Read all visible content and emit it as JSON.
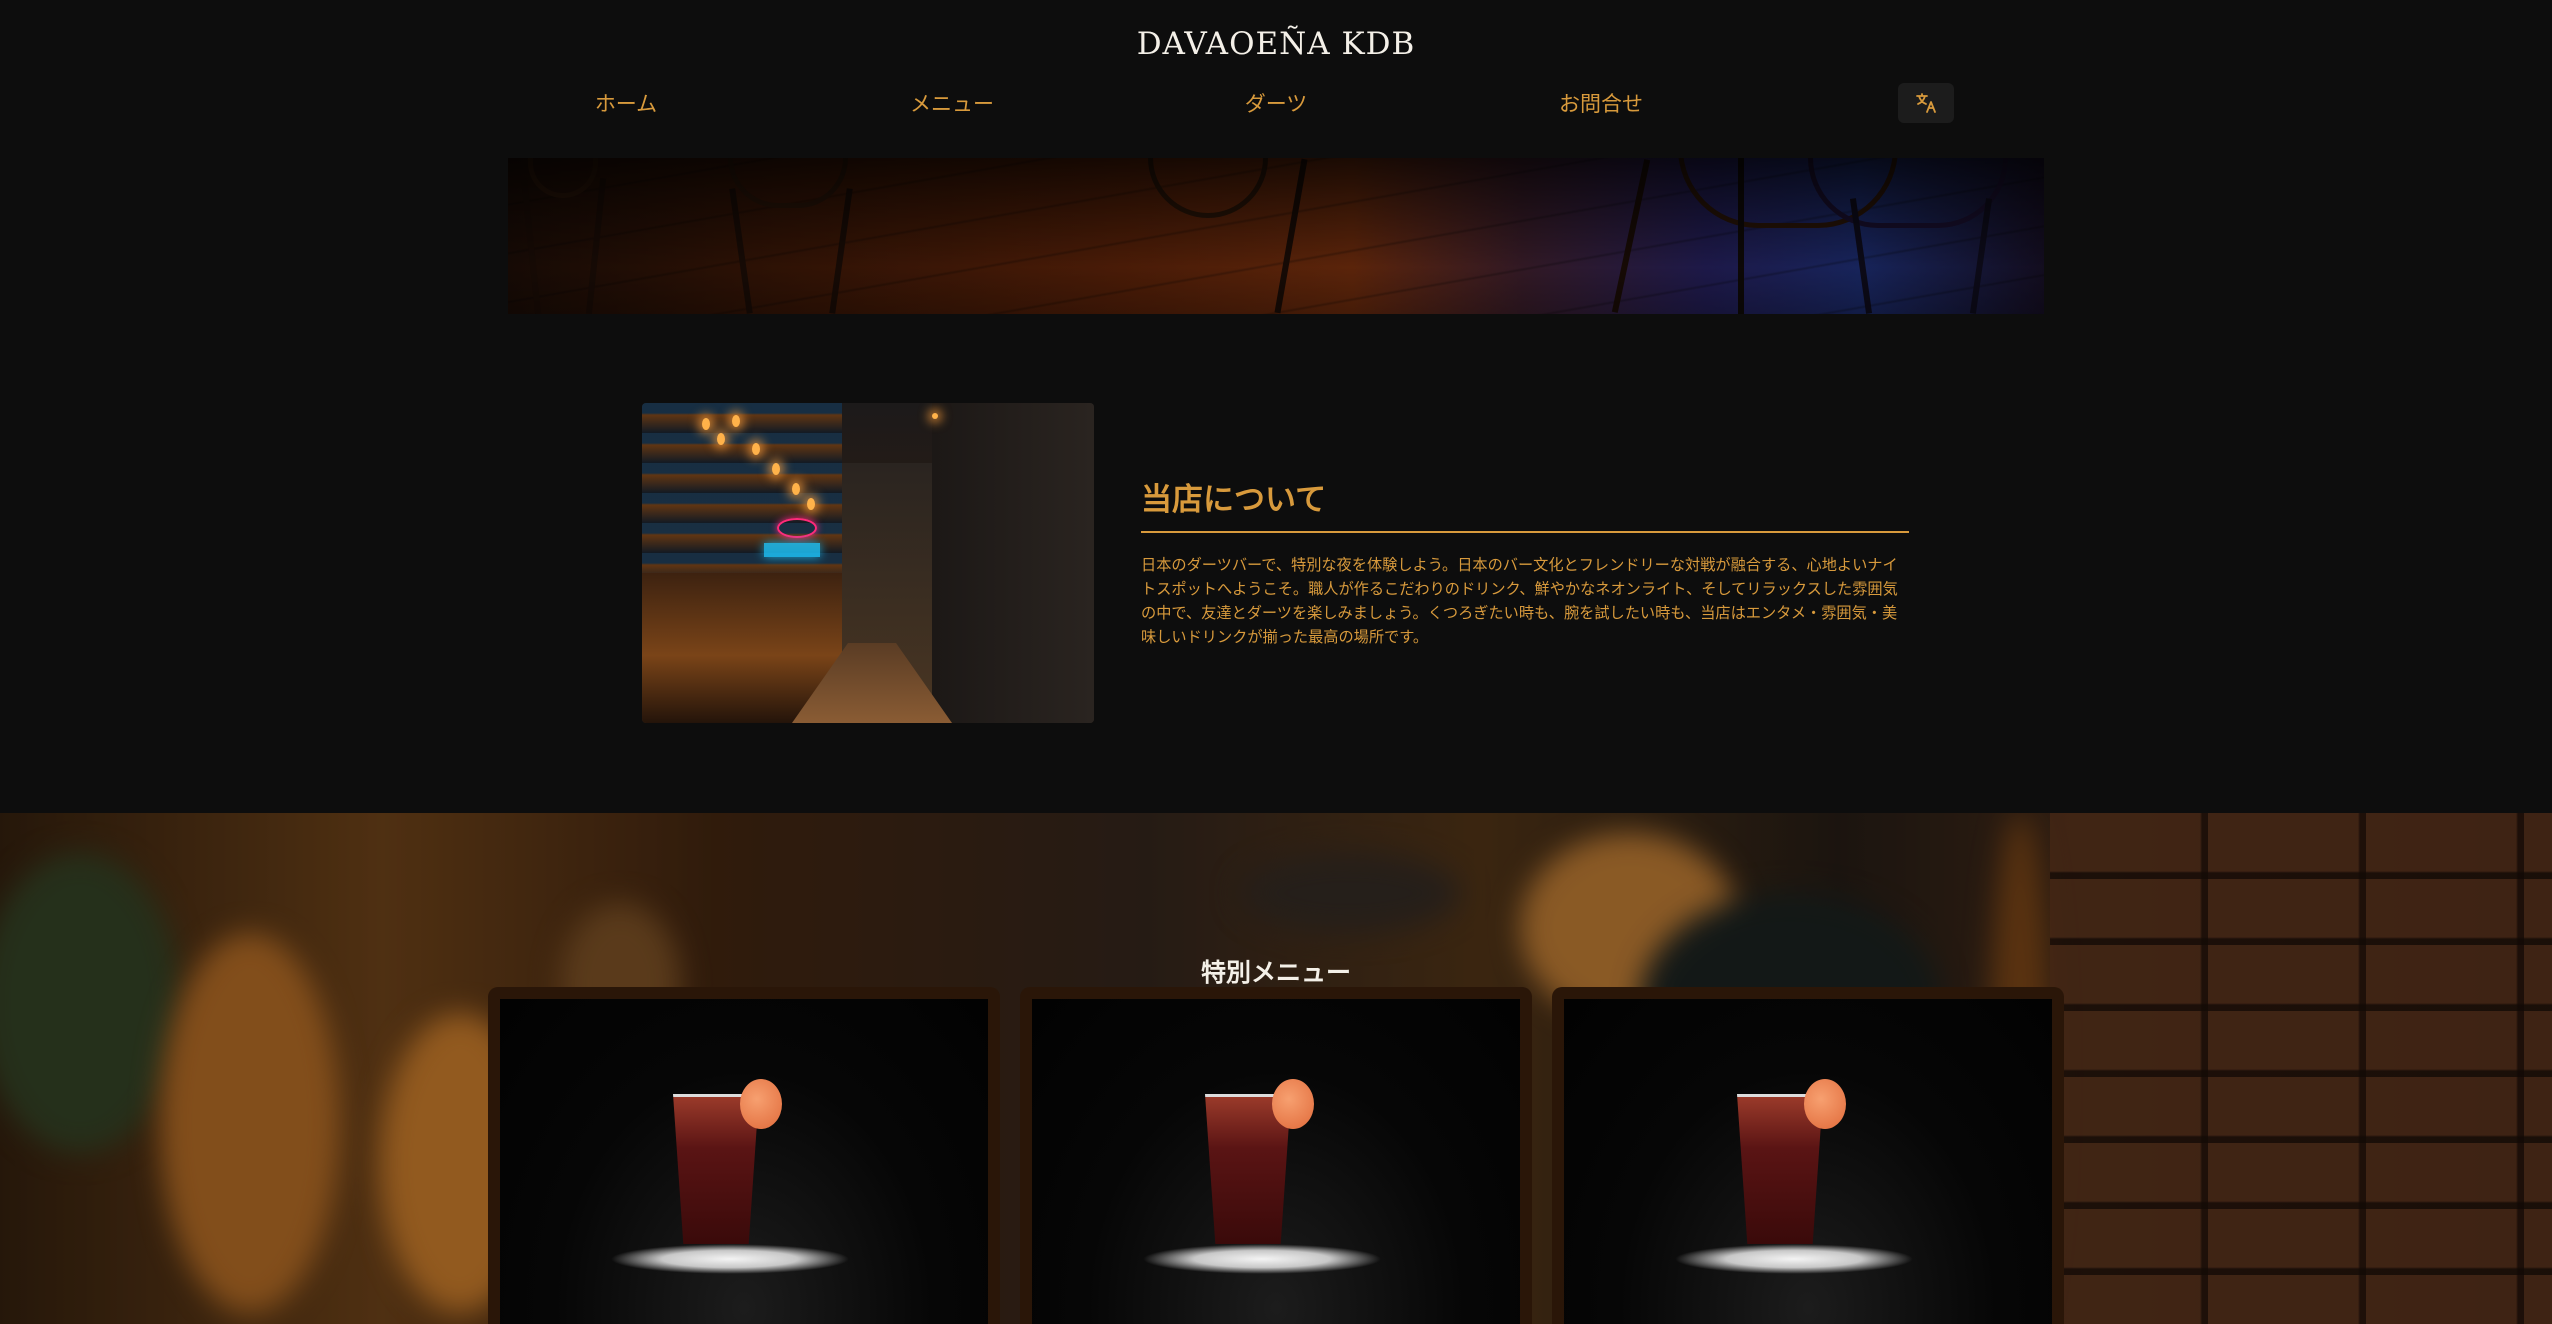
{
  "header": {
    "brand": "DAVAOEÑA KDB",
    "nav": [
      {
        "label": "ホーム"
      },
      {
        "label": "メニュー"
      },
      {
        "label": "ダーツ"
      },
      {
        "label": "お問合せ"
      }
    ],
    "language_icon": "translate-icon"
  },
  "about": {
    "title": "当店について",
    "body": "日本のダーツバーで、特別な夜を体験しよう。日本のバー文化とフレンドリーな対戦が融合する、心地よいナイトスポットへようこそ。職人が作るこだわりのドリンク、鮮やかなネオンライト、そしてリラックスした雰囲気の中で、友達とダーツを楽しみましょう。くつろぎたい時も、腕を試したい時も、当店はエンタメ・雰囲気・美味しいドリンクが揃った最高の場所です。"
  },
  "special": {
    "title": "特別メニュー"
  },
  "colors": {
    "background": "#0d0d0d",
    "accent": "#d89a3c",
    "brand_text": "#f4f0e8",
    "card_frame": "#2a1608"
  }
}
